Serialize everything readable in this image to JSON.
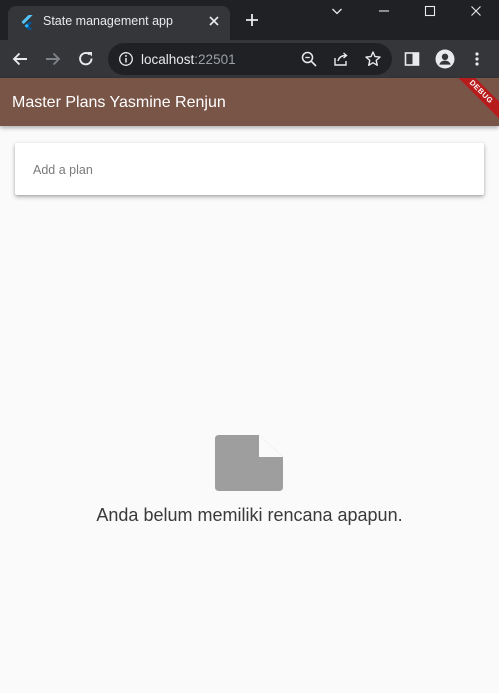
{
  "browser": {
    "tab_title": "State management app",
    "url_host": "localhost",
    "url_port": ":22501"
  },
  "appbar": {
    "title": "Master Plans Yasmine Renjun",
    "debug_badge": "DEBUG",
    "color": "#795548"
  },
  "plan_input": {
    "placeholder": "Add a plan",
    "value": ""
  },
  "empty_state": {
    "icon": "note-icon",
    "message": "Anda belum memiliki rencana apapun."
  }
}
